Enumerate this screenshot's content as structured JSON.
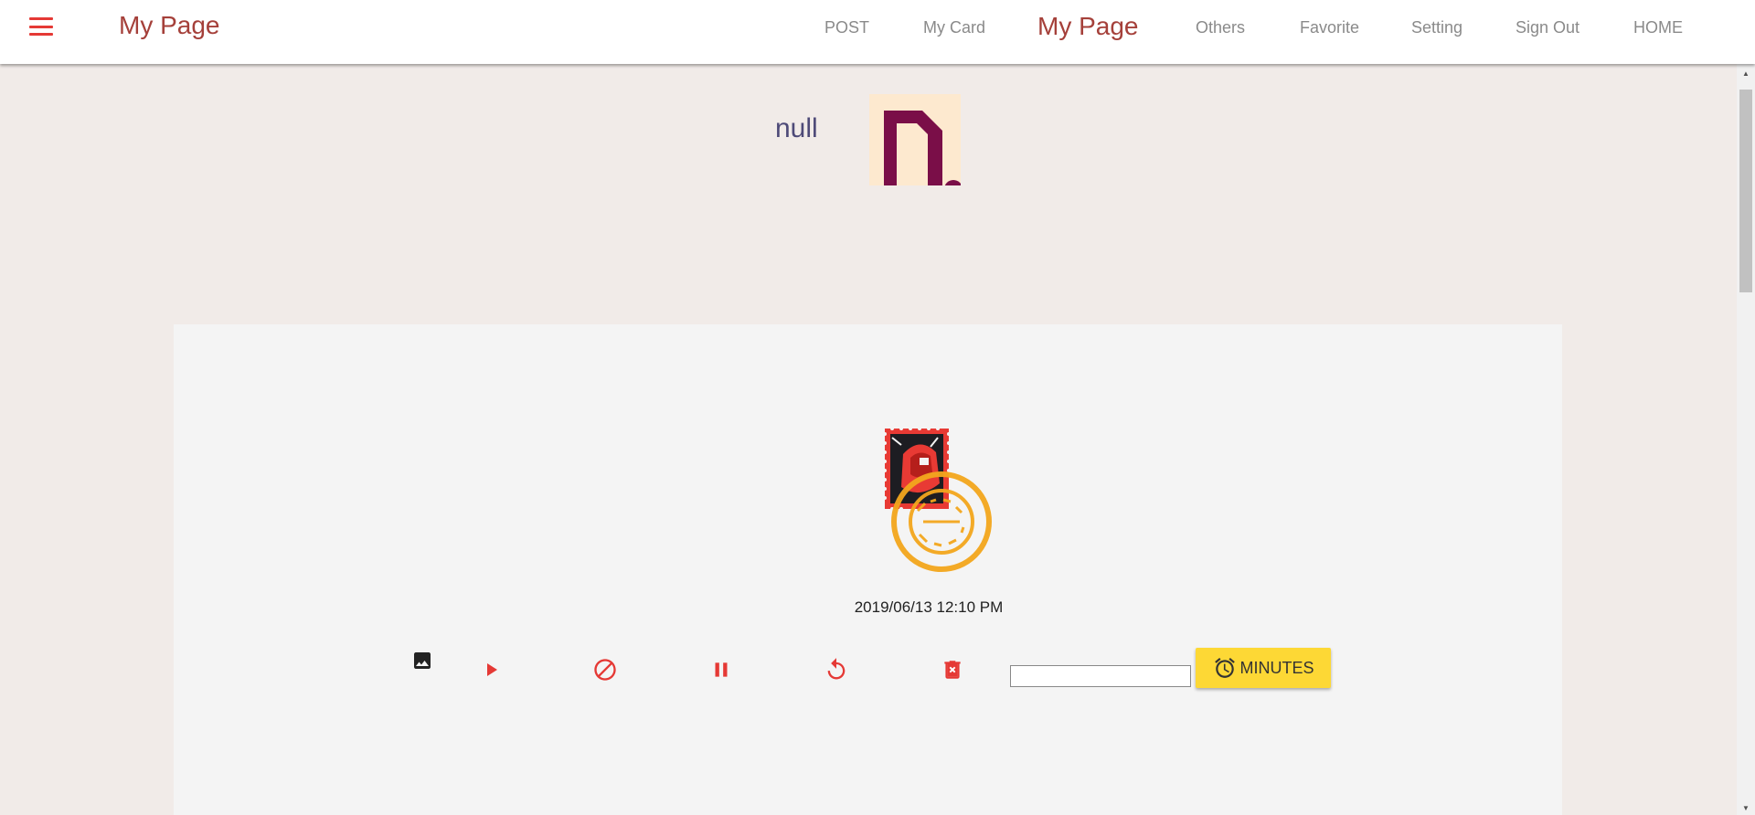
{
  "header": {
    "brand": "My Page",
    "menu_icon": "menu-icon",
    "nav": [
      {
        "label": "POST",
        "active": false
      },
      {
        "label": "My Card",
        "active": false
      },
      {
        "label": "My Page",
        "active": true
      },
      {
        "label": "Others",
        "active": false
      },
      {
        "label": "Favorite",
        "active": false
      },
      {
        "label": "Setting",
        "active": false
      },
      {
        "label": "Sign Out",
        "active": false
      },
      {
        "label": "HOME",
        "active": false
      }
    ]
  },
  "profile": {
    "name": "null",
    "avatar_icon": "avatar-letter-d"
  },
  "card": {
    "image_icon": "postage-stamp-image",
    "date": "2019/06/13 12:10 PM",
    "controls": [
      {
        "name": "image-icon",
        "color": "#222222"
      },
      {
        "name": "play-icon",
        "color": "#e53935"
      },
      {
        "name": "block-icon",
        "color": "#e53935"
      },
      {
        "name": "pause-icon",
        "color": "#e53935"
      },
      {
        "name": "replay-icon",
        "color": "#e53935"
      },
      {
        "name": "delete-icon",
        "color": "#e53935"
      }
    ],
    "minutes_input": {
      "value": "",
      "placeholder": ""
    },
    "minutes_button": {
      "label": "MINUTES",
      "icon": "alarm-clock-icon"
    }
  },
  "colors": {
    "accent": "#e53935",
    "brand": "#a5403a",
    "background": "#f1ebe8",
    "card": "#f4f4f4",
    "button": "#fdd835"
  }
}
